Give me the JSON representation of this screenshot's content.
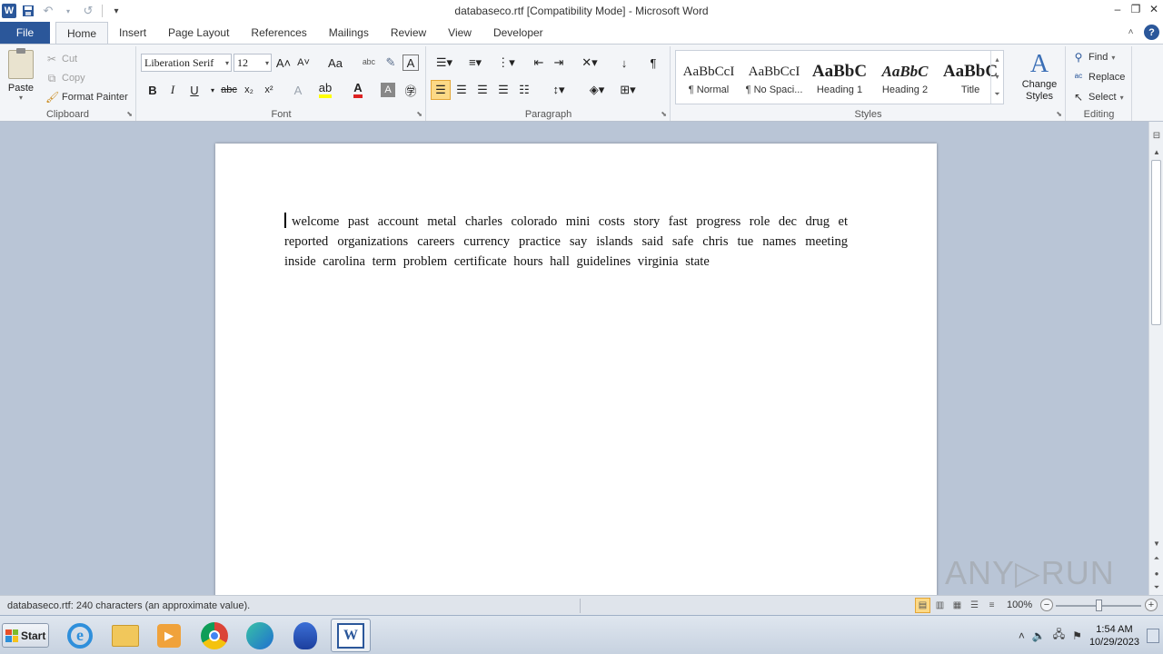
{
  "window": {
    "title": "databaseco.rtf [Compatibility Mode]  -  Microsoft Word",
    "app_icon": "W",
    "controls": [
      "–",
      "❐",
      "✕"
    ]
  },
  "qat": {
    "save_icon": "💾",
    "undo_icon": "↶",
    "redo_icon": "↺",
    "customize_icon": "▾"
  },
  "tabs": [
    {
      "label": "File"
    },
    {
      "label": "Home"
    },
    {
      "label": "Insert"
    },
    {
      "label": "Page Layout"
    },
    {
      "label": "References"
    },
    {
      "label": "Mailings"
    },
    {
      "label": "Review"
    },
    {
      "label": "View"
    },
    {
      "label": "Developer"
    }
  ],
  "ribbon": {
    "clipboard": {
      "label": "Clipboard",
      "paste": "Paste",
      "cut": "Cut",
      "copy": "Copy",
      "format_painter": "Format Painter"
    },
    "font": {
      "label": "Font",
      "font_name": "Liberation Serif",
      "font_size": "12",
      "bold": "B",
      "italic": "I",
      "underline": "U",
      "strike": "abc",
      "subscript": "x₂",
      "superscript": "x²",
      "grow": "A˄",
      "shrink": "A˅",
      "case": "Aa",
      "clear": "A"
    },
    "paragraph": {
      "label": "Paragraph",
      "show_marks": "¶"
    },
    "styles": {
      "label": "Styles",
      "items": [
        {
          "preview": "AaBbCcI",
          "name": "¶ Normal"
        },
        {
          "preview": "AaBbCcI",
          "name": "¶ No Spaci..."
        },
        {
          "preview": "AaBbC",
          "name": "Heading 1"
        },
        {
          "preview": "AaBbC",
          "name": "Heading 2"
        },
        {
          "preview": "AaBbC",
          "name": "Title"
        }
      ],
      "change_styles": "Change Styles"
    },
    "editing": {
      "label": "Editing",
      "find": "Find",
      "replace": "Replace",
      "select": "Select"
    }
  },
  "document": {
    "text": "welcome     past account metal       charles     colorado mini  costs story fast progress role  dec drug et     reported     organizations  careers currency  practice       say     islands       said safe chris  tue names  meeting  inside         carolina  term  problem  certificate       hours  hall  guidelines       virginia state"
  },
  "watermark": "ANY▷RUN",
  "status": {
    "text": "databaseco.rtf: 240 characters (an approximate value).",
    "zoom": "100%",
    "zoom_fraction": 0.5
  },
  "taskbar": {
    "start": "Start",
    "time": "1:54 AM",
    "date": "10/29/2023"
  },
  "colors": {
    "accent": "#2b579a",
    "ribbon_bg": "#f3f5f8",
    "doc_bg": "#b9c5d6"
  }
}
